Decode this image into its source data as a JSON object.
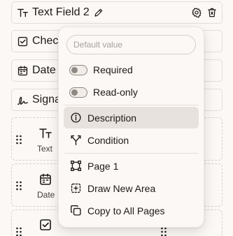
{
  "fields": {
    "active": {
      "title": "Text Field 2",
      "icon": "text-type-icon"
    },
    "rows": [
      {
        "label": "Checkbox",
        "visible": "Chec",
        "icon": "checkbox-icon"
      },
      {
        "label": "Date",
        "visible": "Date",
        "icon": "calendar-icon"
      },
      {
        "label": "Signature",
        "visible": "Signa",
        "icon": "signature-icon"
      }
    ]
  },
  "palette": {
    "row1": {
      "label": "Text",
      "icon": "text-type-icon"
    },
    "row2": {
      "label": "Date",
      "icon": "calendar-icon"
    },
    "row3": {
      "icon": "checkbox-icon"
    }
  },
  "menu": {
    "default_value_placeholder": "Default value",
    "toggles": [
      {
        "label": "Required",
        "on": false
      },
      {
        "label": "Read-only",
        "on": false
      }
    ],
    "items": [
      {
        "label": "Description",
        "icon": "info-icon",
        "highlighted": true
      },
      {
        "label": "Condition",
        "icon": "split-arrows-icon"
      },
      {
        "label": "Page 1",
        "icon": "frame-corners-icon"
      },
      {
        "label": "Draw New Area",
        "icon": "dashed-plus-square-icon"
      },
      {
        "label": "Copy to All Pages",
        "icon": "copy-icon"
      }
    ]
  },
  "colors": {
    "background": "#fbf8f5",
    "border": "#e4ded9",
    "highlight": "#e7e2dd",
    "text": "#1c1917"
  }
}
